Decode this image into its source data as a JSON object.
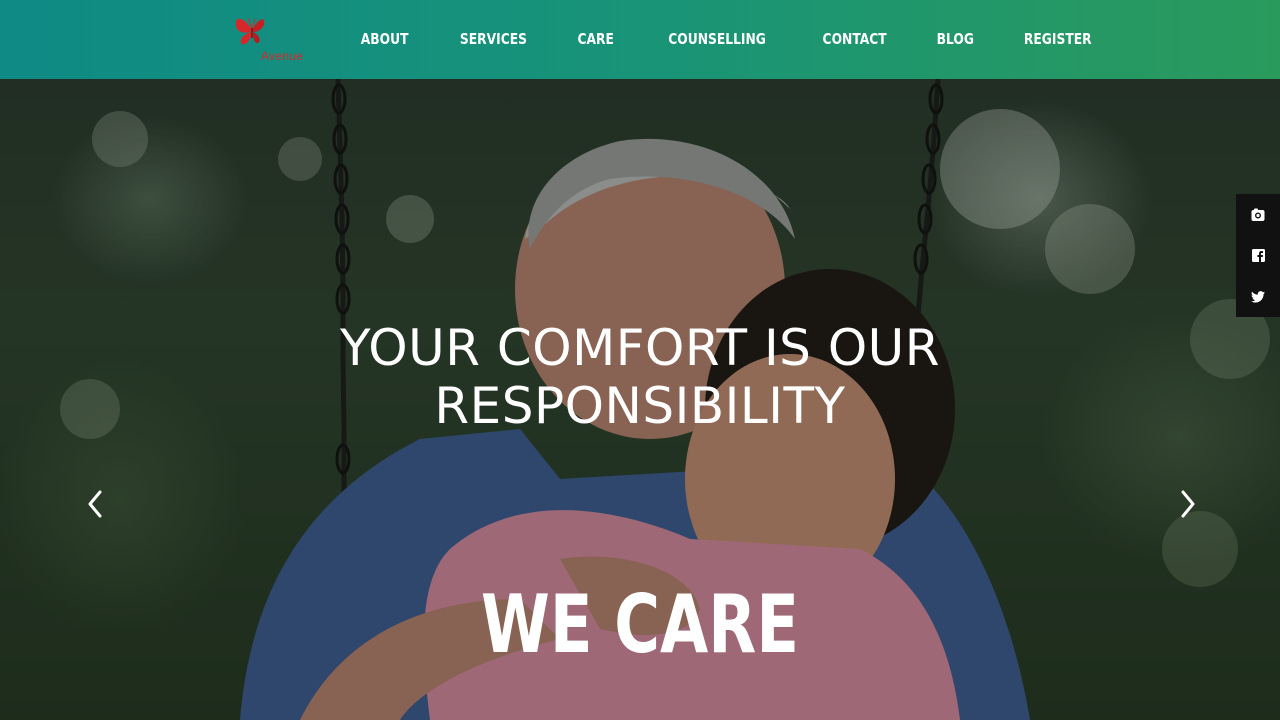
{
  "brand": {
    "logo_text": "Avenue"
  },
  "nav": {
    "items": [
      {
        "label": "ABOUT"
      },
      {
        "label": "SERVICES"
      },
      {
        "label": "CARE"
      },
      {
        "label": "COUNSELLING"
      },
      {
        "label": "CONTACT"
      },
      {
        "label": "BLOG"
      },
      {
        "label": "REGISTER"
      }
    ]
  },
  "hero": {
    "headline_line1": "YOUR COMFORT IS OUR",
    "headline_line2": "RESPONSIBILITY",
    "tagline": "WE CARE",
    "prev_icon": "chevron-left-icon",
    "next_icon": "chevron-right-icon"
  },
  "social": {
    "items": [
      {
        "icon": "instagram-icon"
      },
      {
        "icon": "facebook-icon"
      },
      {
        "icon": "twitter-icon"
      }
    ]
  },
  "colors": {
    "header_start": "#0f8a84",
    "header_end": "#2a9a5c",
    "logo_red": "#d6282b",
    "text": "#ffffff",
    "social_bg": "#111111"
  }
}
